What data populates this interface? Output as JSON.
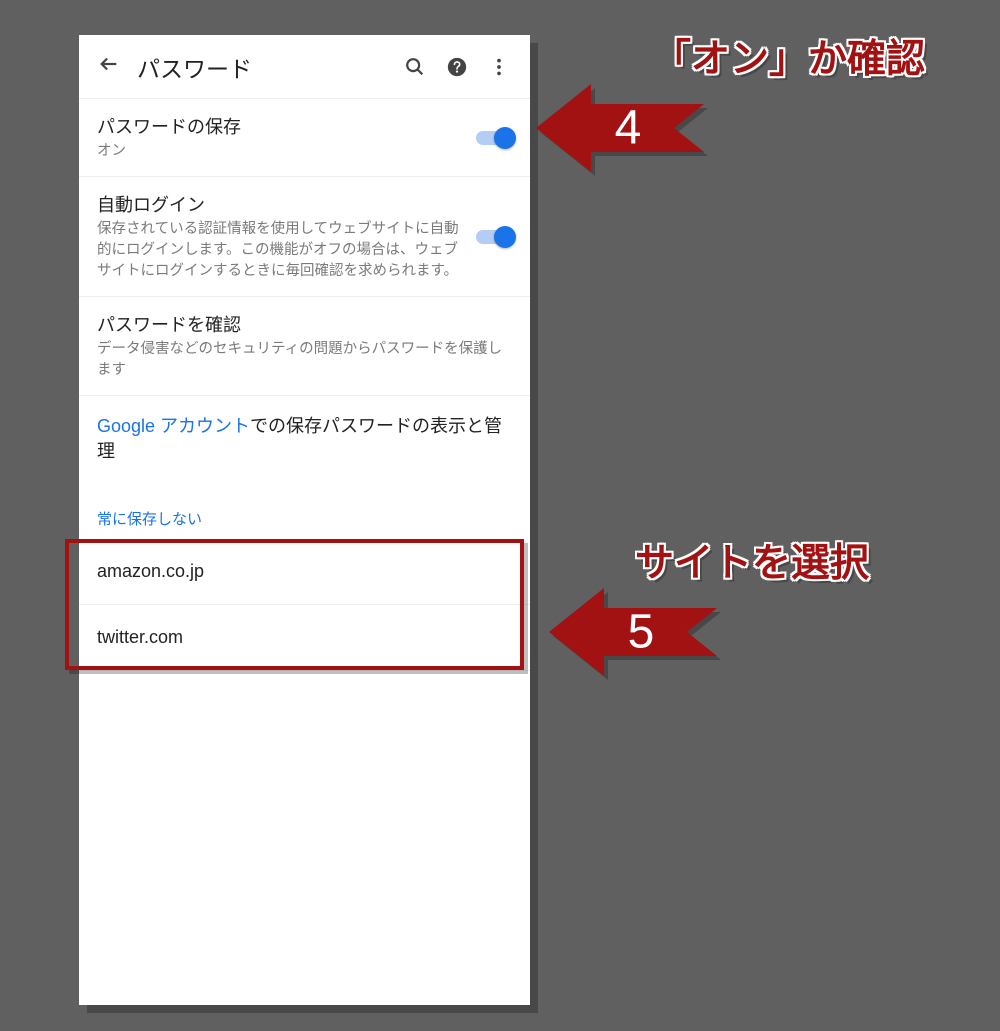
{
  "header": {
    "title": "パスワード"
  },
  "settings": {
    "save_passwords": {
      "title": "パスワードの保存",
      "status": "オン",
      "enabled": true
    },
    "auto_login": {
      "title": "自動ログイン",
      "description": "保存されている認証情報を使用してウェブサイトに自動的にログインします。この機能がオフの場合は、ウェブサイトにログインするときに毎回確認を求められます。",
      "enabled": true
    },
    "check_passwords": {
      "title": "パスワードを確認",
      "description": "データ侵害などのセキュリティの問題からパスワードを保護します"
    }
  },
  "account_notice": {
    "link": "Google アカウント",
    "rest": "での保存パスワードの表示と管理"
  },
  "never_save": {
    "label": "常に保存しない",
    "sites": [
      "amazon.co.jp",
      "twitter.com"
    ]
  },
  "callouts": {
    "c4": {
      "number": "4",
      "text": "「オン」か確認"
    },
    "c5": {
      "number": "5",
      "text": "サイトを選択"
    }
  },
  "colors": {
    "accent": "#1a73e8",
    "annotation": "#a31212"
  }
}
